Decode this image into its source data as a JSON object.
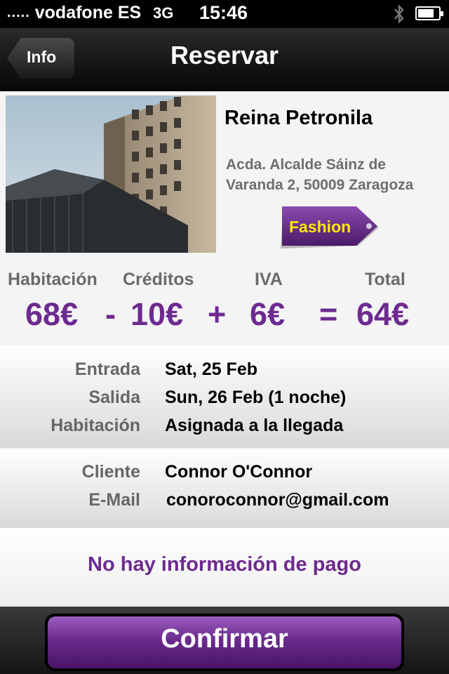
{
  "status_bar": {
    "carrier": "vodafone ES",
    "signal": ".....",
    "network": "3G",
    "time": "15:46",
    "battery_level": 0.8
  },
  "nav": {
    "back_label": "Info",
    "title": "Reservar"
  },
  "hotel": {
    "name": "Reina Petronila",
    "address_line1": "Acda. Alcalde Sáinz de",
    "address_line2": "Varanda 2, 50009 Zaragoza",
    "category_tag": "Fashion"
  },
  "price": {
    "headers": {
      "room": "Habitación",
      "credits": "Créditos",
      "vat": "IVA",
      "total": "Total"
    },
    "room": "68€",
    "minus": "-",
    "credits": "10€",
    "plus": "+",
    "vat": "6€",
    "equals": "=",
    "total": "64€"
  },
  "booking": {
    "checkin_label": "Entrada",
    "checkin_value": "Sat, 25 Feb",
    "checkout_label": "Salida",
    "checkout_value": "Sun, 26 Feb (1 noche)",
    "room_label": "Habitación",
    "room_value": "Asignada a la llegada"
  },
  "client": {
    "name_label": "Cliente",
    "name_value": "Connor O'Connor",
    "email_label": "E-Mail",
    "email_value": "conoroconnor@gmail.com"
  },
  "payment": {
    "message": "No hay información de pago"
  },
  "actions": {
    "confirm_label": "Confirmar"
  },
  "colors": {
    "accent_purple": "#6d2a8f",
    "tag_text": "#ffe800"
  }
}
